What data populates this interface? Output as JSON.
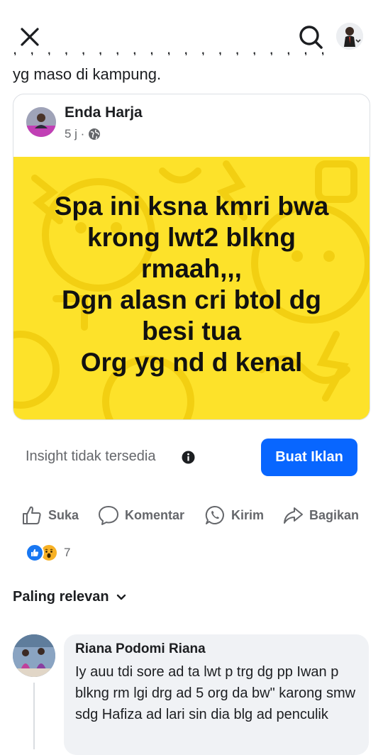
{
  "header": {
    "close_icon": "close-icon",
    "search_icon": "search-icon"
  },
  "post": {
    "continued_text": "yg maso di kampung."
  },
  "shared_post": {
    "author": "Enda Harja",
    "time": "5 j ·",
    "privacy_icon": "globe-icon",
    "image_text": "Spa ini ksna kmri bwa\nkrong lwt2 blkng\nrmaah,,,\nDgn alasn cri btol dg\nbesi tua\nOrg yg nd d kenal",
    "image_bg": "#fde22a"
  },
  "insight": {
    "text": "Insight tidak tersedia",
    "ad_button": "Buat Iklan",
    "ad_color": "#0866ff"
  },
  "actions": {
    "like": "Suka",
    "comment": "Komentar",
    "send": "Kirim",
    "share": "Bagikan"
  },
  "reactions": {
    "count": "7"
  },
  "comments": {
    "sort_label": "Paling relevan",
    "items": [
      {
        "author": "Riana Podomi Riana",
        "text": "Iy auu tdi sore ad ta lwt p trg dg pp Iwan p blkng rm lgi drg ad 5 org da bw\" karong smw sdg Hafiza ad lari sin dia blg ad penculik"
      }
    ]
  }
}
